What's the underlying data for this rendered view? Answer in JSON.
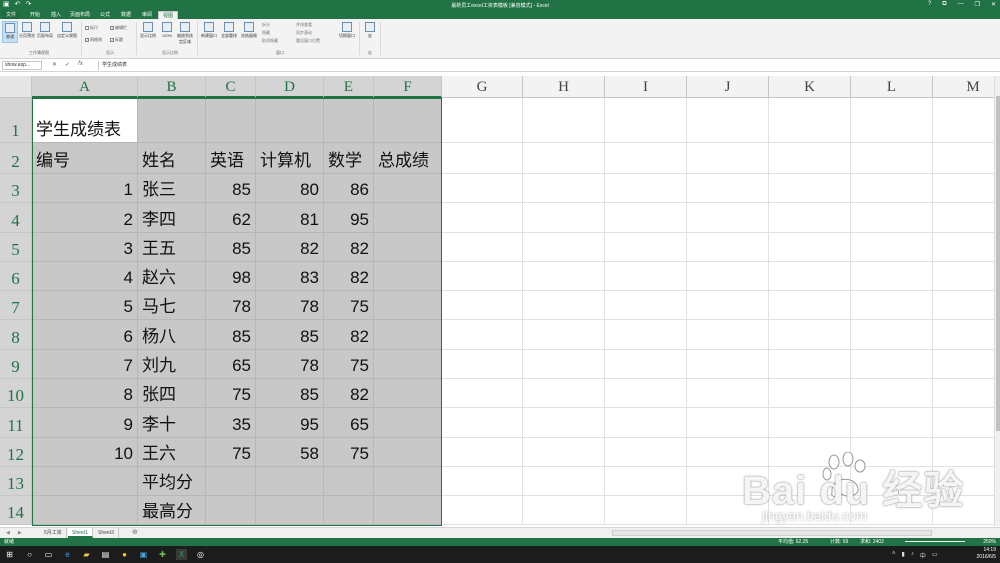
{
  "window": {
    "title": "最新员工excel工资表模板 [兼容模式] - Excel",
    "controls": [
      "?",
      "⧉",
      "—",
      "❐",
      "✕"
    ]
  },
  "quick_access": [
    "save-icon",
    "undo-icon",
    "redo-icon"
  ],
  "ribbon_tabs": [
    "文件",
    "开始",
    "插入",
    "页面布局",
    "公式",
    "数据",
    "审阅",
    "视图"
  ],
  "active_tab": "视图",
  "ribbon": {
    "workbook_views": {
      "buttons": [
        "普通",
        "分页预览",
        "页面布局",
        "自定义视图"
      ],
      "label": "工作簿视图"
    },
    "show": {
      "checks": [
        {
          "label": "标尺",
          "checked": false
        },
        {
          "label": "编辑栏",
          "checked": true
        },
        {
          "label": "网格线",
          "checked": true
        },
        {
          "label": "标题",
          "checked": true
        }
      ],
      "label": "显示"
    },
    "zoom": {
      "buttons": [
        "显示比例",
        "100%",
        "缩放到选定区域"
      ],
      "label": "显示比例"
    },
    "window": {
      "buttons": [
        "新建窗口",
        "全部重排",
        "冻结窗格"
      ],
      "small": [
        "拆分",
        "隐藏",
        "取消隐藏"
      ],
      "small2": [
        "并排查看",
        "同步滚动",
        "重设窗口位置"
      ],
      "switch": "切换窗口",
      "label": "窗口"
    },
    "macro": {
      "button": "宏",
      "label": "宏"
    }
  },
  "formula_bar": {
    "name_box": "show.asp...",
    "content": "学生成绩表"
  },
  "columns": [
    "A",
    "B",
    "C",
    "D",
    "E",
    "F",
    "G",
    "H",
    "I",
    "J",
    "K",
    "L",
    "M"
  ],
  "rows": [
    "1",
    "2",
    "3",
    "4",
    "5",
    "6",
    "7",
    "8",
    "9",
    "10",
    "11",
    "12",
    "13",
    "14"
  ],
  "sheet": {
    "title": "学生成绩表",
    "headers": [
      "编号",
      "姓名",
      "英语",
      "计算机",
      "数学",
      "总成绩"
    ],
    "records": [
      [
        "1",
        "张三",
        "85",
        "80",
        "86"
      ],
      [
        "2",
        "李四",
        "62",
        "81",
        "95"
      ],
      [
        "3",
        "王五",
        "85",
        "82",
        "82"
      ],
      [
        "4",
        "赵六",
        "98",
        "83",
        "82"
      ],
      [
        "5",
        "马七",
        "78",
        "78",
        "75"
      ],
      [
        "6",
        "杨八",
        "85",
        "85",
        "82"
      ],
      [
        "7",
        "刘九",
        "65",
        "78",
        "75"
      ],
      [
        "8",
        "张四",
        "75",
        "85",
        "82"
      ],
      [
        "9",
        "李十",
        "35",
        "95",
        "65"
      ],
      [
        "10",
        "王六",
        "75",
        "58",
        "75"
      ]
    ],
    "footer_rows": [
      "平均分",
      "最高分"
    ]
  },
  "sheet_tabs": [
    "5月工资",
    "Sheet1",
    "Sheet3"
  ],
  "active_sheet": "Sheet1",
  "status_bar": {
    "mode": "就绪",
    "average": "平均值: 62.25",
    "count": "计数: 59",
    "sum": "求和: 2402",
    "zoom": "250%"
  },
  "taskbar": {
    "time": "14:19",
    "date": "2016/6/5"
  },
  "watermark": {
    "brand": "Bai du 经验",
    "url": "jingyan.baidu.com"
  },
  "colors": {
    "excel_green": "#217346",
    "selection_gray": "#c8c8c8",
    "header_gray": "#d4d4d4"
  }
}
